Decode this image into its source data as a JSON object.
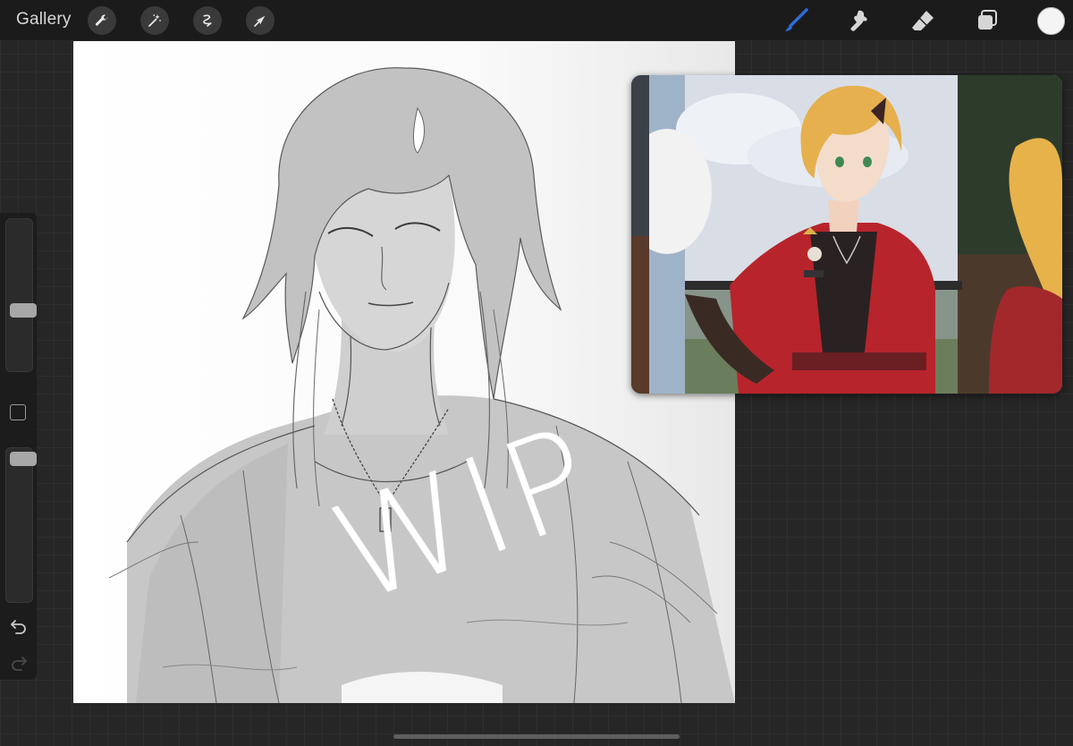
{
  "toolbar": {
    "gallery_label": "Gallery",
    "left_tools": [
      "wrench-icon",
      "magic-wand-icon",
      "selection-icon",
      "transform-arrow-icon"
    ],
    "right_tools": [
      "brush-icon",
      "smudge-icon",
      "eraser-icon",
      "layers-icon"
    ],
    "active_tool": "brush-icon",
    "active_tool_color": "#2f6bd8",
    "current_color": "#f4f4f4"
  },
  "sidebar": {
    "brush_size_icon": "brush-size-slider",
    "opacity_icon": "opacity-slider",
    "modify_icon": "square-modify-icon",
    "undo_icon": "undo-icon",
    "redo_icon": "redo-icon"
  },
  "canvas": {
    "wip_label": "WIP"
  },
  "reference": {
    "icon": "reference-window"
  }
}
